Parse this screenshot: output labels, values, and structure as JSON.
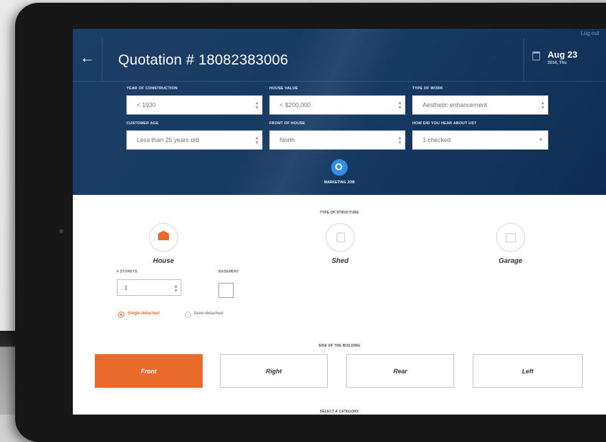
{
  "header": {
    "logout": "Log out",
    "title": "Quotation # 18082383006",
    "date": "Aug 23",
    "date_sub": "2016, Thu"
  },
  "form": {
    "year": {
      "label": "YEAR OF CONSTRUCTION",
      "value": "< 1930"
    },
    "house_value": {
      "label": "HOUSE VALUE",
      "value": "< $200,000"
    },
    "work_type": {
      "label": "TYPE OF WORK",
      "value": "Aesthetic enhancement"
    },
    "customer_age": {
      "label": "CUSTOMER AGE",
      "value": "Less than 25 years old"
    },
    "front": {
      "label": "FRONT OF HOUSE",
      "value": "North"
    },
    "heard": {
      "label": "HOW DID YOU HEAR ABOUT US?",
      "value": "1 checked"
    }
  },
  "marketing_job": "MARKETING JOB",
  "structure": {
    "title": "TYPE OF STRUCTURE",
    "options": [
      {
        "label": "House",
        "selected": true
      },
      {
        "label": "Shed",
        "selected": false
      },
      {
        "label": "Garage",
        "selected": false
      }
    ]
  },
  "storeys": {
    "label": "# STOREYS",
    "value": "1"
  },
  "basement": {
    "label": "BASEMENT"
  },
  "detached": {
    "option1": "Single detached",
    "option2": "Semi-detached"
  },
  "side": {
    "title": "SIDE OF THE BUILDING",
    "options": [
      "Front",
      "Right",
      "Rear",
      "Left"
    ]
  },
  "category": {
    "title": "SELECT A CATEGORY"
  },
  "colors": {
    "accent": "#ea6a2c",
    "header": "#173a63",
    "brand_blue": "#2f8fe0"
  }
}
